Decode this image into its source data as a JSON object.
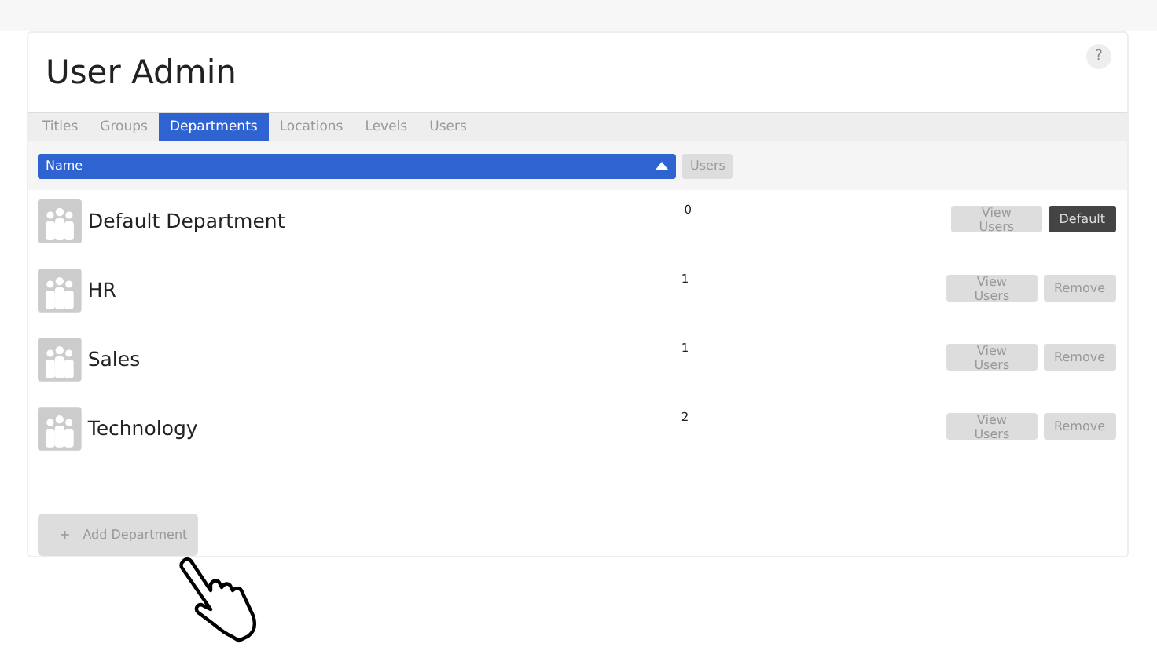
{
  "title": "User Admin",
  "help": "?",
  "tabs": [
    {
      "label": "Titles",
      "selected": false
    },
    {
      "label": "Groups",
      "selected": false
    },
    {
      "label": "Departments",
      "selected": true
    },
    {
      "label": "Locations",
      "selected": false
    },
    {
      "label": "Levels",
      "selected": false
    },
    {
      "label": "Users",
      "selected": false
    }
  ],
  "columns": [
    {
      "label": "Name",
      "selected": true
    },
    {
      "label": "Users",
      "selected": false
    }
  ],
  "rows": [
    {
      "name": "Default Department",
      "users": "0",
      "buttons": [
        {
          "label": "View Users",
          "kind": "plain"
        },
        {
          "label": "Default",
          "kind": "dark"
        }
      ]
    },
    {
      "name": "HR",
      "users": "1",
      "buttons": [
        {
          "label": "View Users",
          "kind": "plain"
        },
        {
          "label": "Remove",
          "kind": "plain"
        }
      ]
    },
    {
      "name": "Sales",
      "users": "1",
      "buttons": [
        {
          "label": "View Users",
          "kind": "plain"
        },
        {
          "label": "Remove",
          "kind": "plain"
        }
      ]
    },
    {
      "name": "Technology",
      "users": "2",
      "buttons": [
        {
          "label": "View Users",
          "kind": "plain"
        },
        {
          "label": "Remove",
          "kind": "plain"
        }
      ]
    }
  ],
  "add_button": {
    "icon": "+",
    "label": "Add Department"
  }
}
